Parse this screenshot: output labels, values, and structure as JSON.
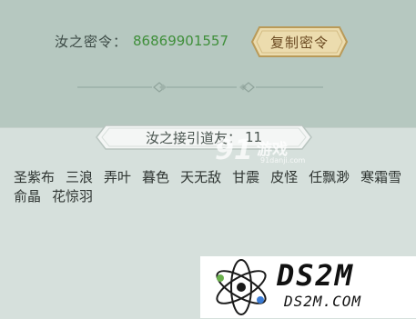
{
  "password": {
    "label": "汝之密令：",
    "value": "86869901557",
    "copy_button_label": "复制密令"
  },
  "friends": {
    "header_label": "汝之接引道友：",
    "count": "11",
    "names": [
      "圣紫布",
      "三浪",
      "弄叶",
      "暮色",
      "天无敌",
      "甘震",
      "皮怪",
      "任飘渺",
      "寒霜雪",
      "俞晶",
      "花惊羽"
    ]
  },
  "watermarks": {
    "site91_number": "91",
    "site91_text": "游戏",
    "site91_url": "91danji.com",
    "ds2m_title": "DS2M",
    "ds2m_url": "DS2M.COM"
  },
  "colors": {
    "background": "#b7c9c1",
    "panel": "#d6e0dc",
    "password_value": "#3f8f3a",
    "button_fill": "#ecdcae",
    "button_border": "#b99a58"
  }
}
